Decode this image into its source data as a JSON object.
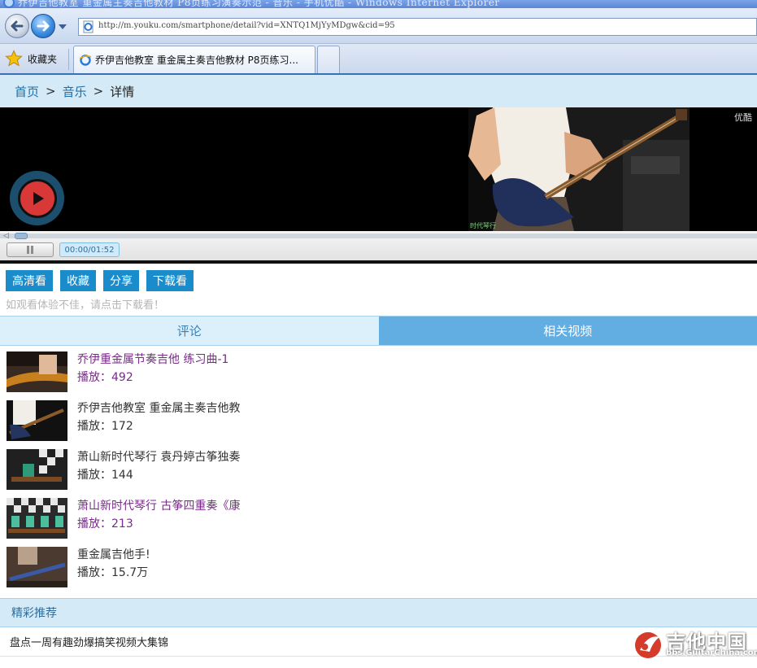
{
  "window": {
    "title": "乔伊吉他教室 重金属主奏吉他教材 P8页练习演奏示范 - 音乐 - 手机优酷 - Windows Internet Explorer",
    "url": "http://m.youku.com/smartphone/detail?vid=XNTQ1MjYyMDgw&cid=95",
    "favorites_label": "收藏夹",
    "tab_title": "乔伊吉他教室 重金属主奏吉他教材 P8页练习..."
  },
  "breadcrumb": {
    "home": "首页",
    "music": "音乐",
    "current": "详情",
    "sep": ">"
  },
  "player": {
    "logo": "优酷",
    "studio_caption": "时代琴行",
    "time": "00:00/01:52",
    "progress": 0
  },
  "actions": {
    "hd": "高清看",
    "fav": "收藏",
    "share": "分享",
    "download": "下载看"
  },
  "hint": "如观看体验不佳，请点击下载看！",
  "tabs": {
    "comments": "评论",
    "related": "相关视频"
  },
  "related_videos": [
    {
      "title": "乔伊重金属节奏吉他 练习曲-1",
      "plays": "播放：492",
      "visited": true
    },
    {
      "title": "乔伊吉他教室 重金属主奏吉他教",
      "plays": "播放：172",
      "visited": false
    },
    {
      "title": "萧山新时代琴行 袁丹婷古筝独奏",
      "plays": "播放：144",
      "visited": false
    },
    {
      "title": "萧山新时代琴行 古筝四重奏《康",
      "plays": "播放：213",
      "visited": true
    },
    {
      "title": "重金属吉他手!",
      "plays": "播放：15.7万",
      "visited": false
    }
  ],
  "recommend": {
    "heading": "精彩推荐",
    "items": [
      "盘点一周有趣劲爆搞笑视频大集锦"
    ]
  },
  "watermark": {
    "text": "吉他中国",
    "sub": "bbs.GuitarChina.com"
  },
  "colors": {
    "accent": "#1a8ccc",
    "tab_active": "#62aee2",
    "light_band": "#d4eaf7",
    "visited_link": "#7a2a8a"
  }
}
